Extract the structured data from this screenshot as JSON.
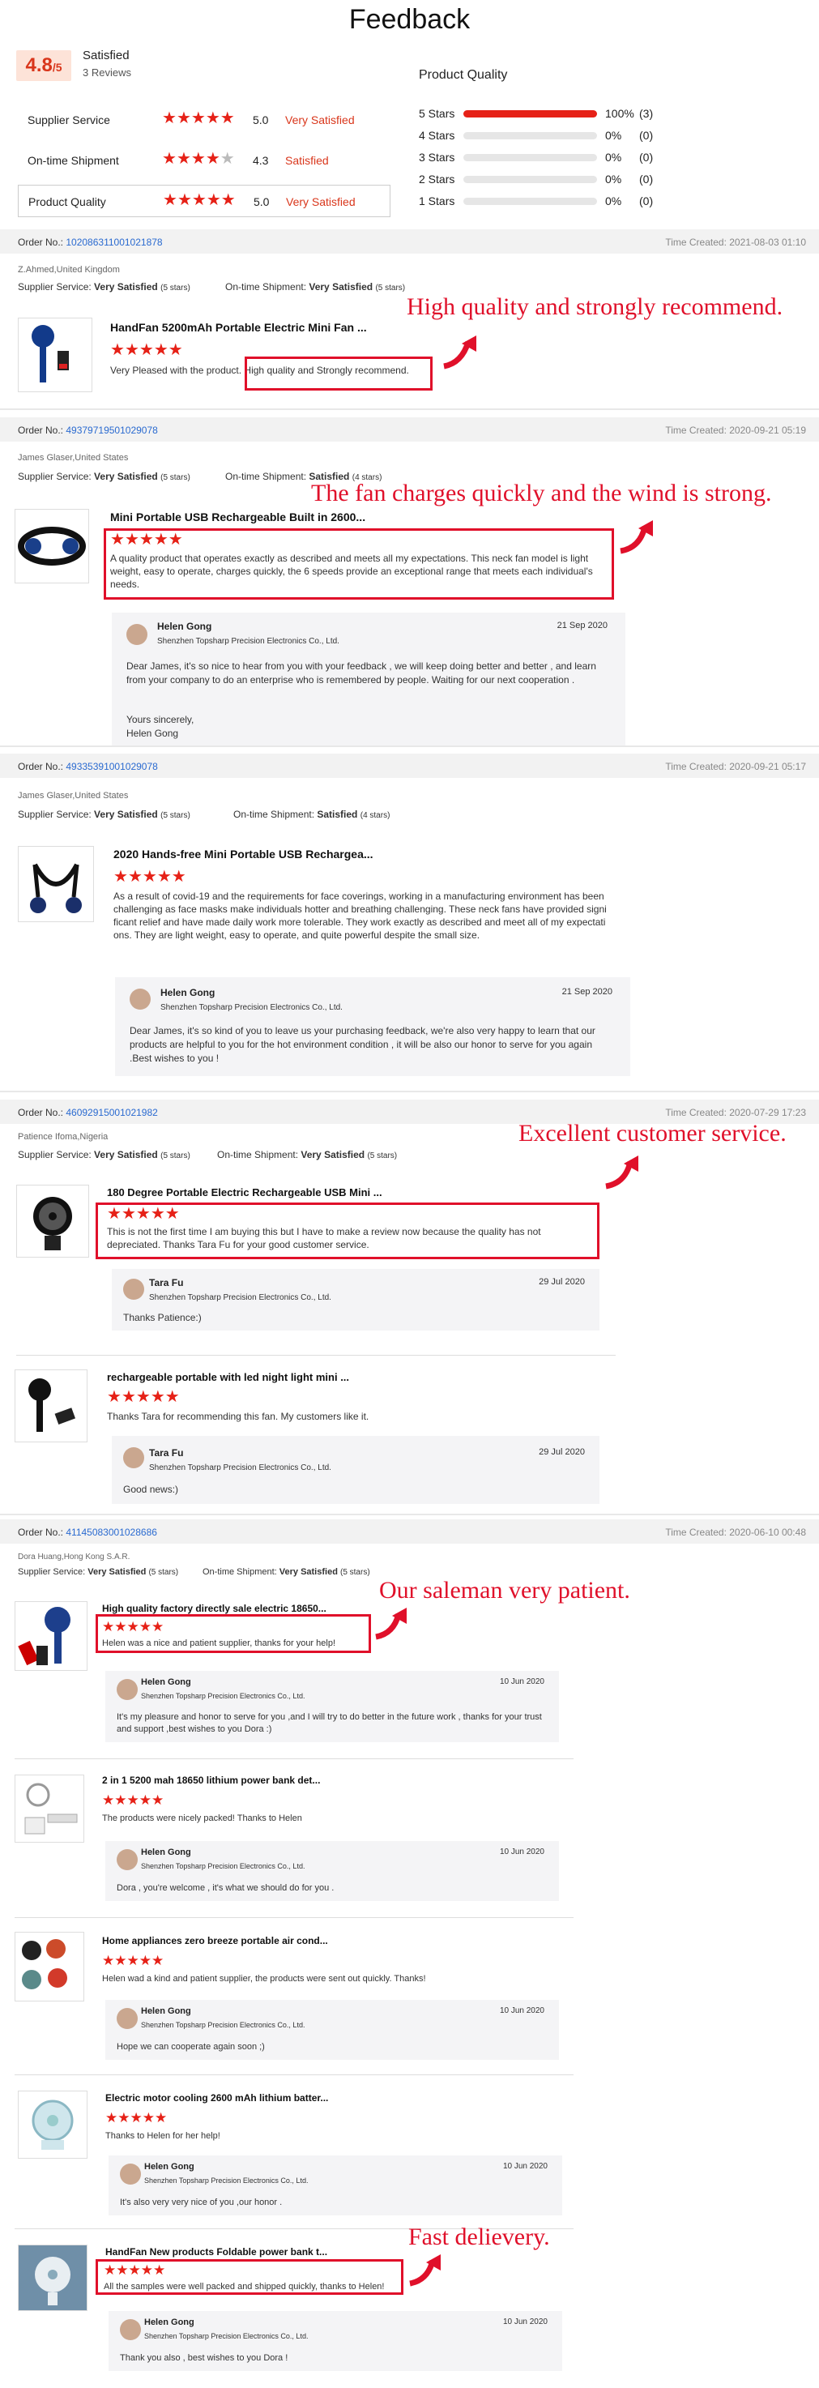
{
  "header": {
    "title": "Feedback",
    "score": "4.8",
    "score_suffix": "/5",
    "satisfied": "Satisfied",
    "reviews": "3 Reviews"
  },
  "metrics": [
    {
      "label": "Supplier Service",
      "stars": 5,
      "value": "5.0",
      "text": "Very Satisfied"
    },
    {
      "label": "On-time Shipment",
      "stars": 4.5,
      "value": "4.3",
      "text": "Satisfied"
    },
    {
      "label": "Product Quality",
      "stars": 5,
      "value": "5.0",
      "text": "Very Satisfied"
    }
  ],
  "quality": {
    "title": "Product Quality",
    "rows": [
      {
        "label": "5 Stars",
        "fraction": 1.0,
        "pct": "100%",
        "count": "(3)"
      },
      {
        "label": "4 Stars",
        "fraction": 0,
        "pct": "0%",
        "count": "(0)"
      },
      {
        "label": "3 Stars",
        "fraction": 0,
        "pct": "0%",
        "count": "(0)"
      },
      {
        "label": "2 Stars",
        "fraction": 0,
        "pct": "0%",
        "count": "(0)"
      },
      {
        "label": "1 Stars",
        "fraction": 0,
        "pct": "0%",
        "count": "(0)"
      }
    ]
  },
  "labels": {
    "order_no": "Order No.: ",
    "supplier_service": "Supplier Service: ",
    "ontime": "On-time Shipment: ",
    "very_satisfied": "Very Satisfied",
    "satisfied": "Satisfied",
    "five_stars": "(5 stars)",
    "four_stars": "(4 stars)"
  },
  "orders": [
    {
      "order": "102086311001021878",
      "time": "Time Created: 2021-08-03 01:10",
      "buyer": "Z.Ahmed,United Kingdom",
      "ship": "Very Satisfied",
      "ship_stars": "(5 stars)",
      "items": [
        {
          "name": "HandFan 5200mAh Portable Electric Mini Fan ...",
          "review": "Very Pleased with the product. High quality and Strongly recommend.",
          "annotation": "High quality and strongly recommend."
        }
      ]
    },
    {
      "order": "49379719501029078",
      "time": "Time Created: 2020-09-21 05:19",
      "buyer": "James Glaser,United States",
      "ship": "Satisfied",
      "ship_stars": "(4 stars)",
      "items": [
        {
          "name": "Mini Portable USB Rechargeable Built in 2600...",
          "review": "A quality product that operates exactly as described and meets all my expectations. This neck fan model is light weight, easy to operate, charges quickly, the 6 speeds provide an exceptional range that meets each individual's needs.",
          "annotation": "The fan charges quickly and the wind is strong.",
          "reply": {
            "name": "Helen Gong",
            "company": "Shenzhen Topsharp Precision Electronics Co., Ltd.",
            "date": "21 Sep 2020",
            "text": "Dear James, it's so nice to hear from you with your feedback , we will keep doing  better and better , and learn from your company to do an enterprise who is remembered by people.  Waiting for our next cooperation .",
            "closing": "Yours sincerely,",
            "sign": "Helen Gong"
          }
        }
      ]
    },
    {
      "order": "49335391001029078",
      "time": "Time Created: 2020-09-21 05:17",
      "buyer": "James Glaser,United States",
      "ship": "Satisfied",
      "ship_stars": "(4 stars)",
      "items": [
        {
          "name": "2020 Hands-free Mini Portable USB Rechargea...",
          "review": "As a result of covid-19 and the requirements for face coverings, working in a manufacturing environment has been challenging as face masks make individuals hotter and breathing challenging. These neck fans have provided significant relief and have made daily work more tolerable. They work exactly as described and meet all of my expectations. They are light weight, easy to operate, and quite powerful despite the small size.",
          "reply": {
            "name": "Helen Gong",
            "company": "Shenzhen Topsharp Precision Electronics Co., Ltd.",
            "date": "21 Sep 2020",
            "text": "Dear James, it's so kind of you to leave us your purchasing feedback, we're also very happy to learn that our products are helpful to you for the hot environment condition ,  it will be also our honor to serve for you again .Best wishes to you !"
          }
        }
      ]
    },
    {
      "order": "46092915001021982",
      "time": "Time Created: 2020-07-29 17:23",
      "buyer": "Patience Ifoma,Nigeria",
      "ship": "Very Satisfied",
      "ship_stars": "(5 stars)",
      "items": [
        {
          "name": "180 Degree Portable Electric Rechargeable USB Mini ...",
          "review": "This is not the first time I am buying this but I have to make a review now because the quality has not depreciated. Thanks Tara Fu for your good customer service.",
          "annotation": "Excellent customer service.",
          "reply": {
            "name": "Tara Fu",
            "company": "Shenzhen Topsharp Precision Electronics Co., Ltd.",
            "date": "29 Jul 2020",
            "text": "Thanks Patience:)"
          }
        },
        {
          "name": "rechargeable portable with led night light mini ...",
          "review": "Thanks Tara for recommending this fan. My customers like it.",
          "reply": {
            "name": "Tara Fu",
            "company": "Shenzhen Topsharp Precision Electronics Co., Ltd.",
            "date": "29 Jul 2020",
            "text": "Good news:)"
          }
        }
      ]
    },
    {
      "order": "41145083001028686",
      "time": "Time Created: 2020-06-10 00:48",
      "buyer": "Dora Huang,Hong Kong S.A.R.",
      "ship": "Very Satisfied",
      "ship_stars": "(5 stars)",
      "items": [
        {
          "name": "High quality factory directly sale electric 18650...",
          "review": "Helen was a nice and patient supplier, thanks for your help!",
          "annotation": "Our saleman very patient.",
          "reply": {
            "name": "Helen Gong",
            "company": "Shenzhen Topsharp Precision Electronics Co., Ltd.",
            "date": "10 Jun 2020",
            "text": "It's my pleasure and honor to serve for you ,and I will try to do better in the future work , thanks for your trust and support ,best wishes to you Dora :)"
          }
        },
        {
          "name": "2 in 1 5200 mah 18650 lithium power bank det...",
          "review": "The products were nicely packed! Thanks to Helen",
          "reply": {
            "name": "Helen Gong",
            "company": "Shenzhen Topsharp Precision Electronics Co., Ltd.",
            "date": "10 Jun 2020",
            "text": "Dora , you're welcome , it's what we should do for you ."
          }
        },
        {
          "name": "Home appliances zero breeze portable air cond...",
          "review": "Helen wad a kind and patient supplier, the products were sent out quickly. Thanks!",
          "reply": {
            "name": "Helen Gong",
            "company": "Shenzhen Topsharp Precision Electronics Co., Ltd.",
            "date": "10 Jun 2020",
            "text": "Hope we can cooperate again soon ;)"
          }
        },
        {
          "name": "Electric motor cooling 2600 mAh lithium batter...",
          "review": "Thanks to Helen for her help!",
          "reply": {
            "name": "Helen Gong",
            "company": "Shenzhen Topsharp Precision Electronics Co., Ltd.",
            "date": "10 Jun 2020",
            "text": "It's also very very nice of you ,our honor ."
          }
        },
        {
          "name": "HandFan New products Foldable power bank t...",
          "review": "All the samples were well packed and shipped quickly, thanks to Helen!",
          "annotation": "Fast delievery.",
          "reply": {
            "name": "Helen Gong",
            "company": "Shenzhen Topsharp Precision Electronics Co., Ltd.",
            "date": "10 Jun 2020",
            "text": "Thank you also , best wishes to you Dora !"
          }
        }
      ]
    }
  ],
  "colors": {
    "accent": "#e62117",
    "link": "#2a6ad0",
    "score_bg": "#fde3d8"
  }
}
